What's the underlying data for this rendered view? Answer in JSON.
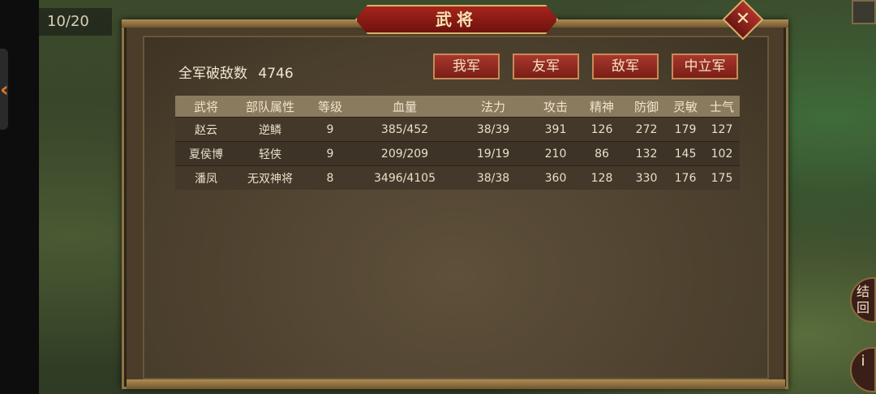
{
  "game": {
    "turn_counter": "10/20",
    "side_buttons": [
      "结\n回",
      "i"
    ]
  },
  "dialog": {
    "title": "武将",
    "close_label": "✕",
    "kills_label": "全军破敌数",
    "kills_value": "4746",
    "factions": [
      "我军",
      "友军",
      "敌军",
      "中立军"
    ]
  },
  "table": {
    "headers": [
      "武将",
      "部队属性",
      "等级",
      "血量",
      "法力",
      "攻击",
      "精神",
      "防御",
      "灵敏",
      "士气"
    ],
    "rows": [
      [
        "赵云",
        "逆鳞",
        "9",
        "385/452",
        "38/39",
        "391",
        "126",
        "272",
        "179",
        "127"
      ],
      [
        "夏侯博",
        "轻侠",
        "9",
        "209/209",
        "19/19",
        "210",
        "86",
        "132",
        "145",
        "102"
      ],
      [
        "潘凤",
        "无双神将",
        "8",
        "3496/4105",
        "38/38",
        "360",
        "128",
        "330",
        "176",
        "175"
      ]
    ]
  }
}
